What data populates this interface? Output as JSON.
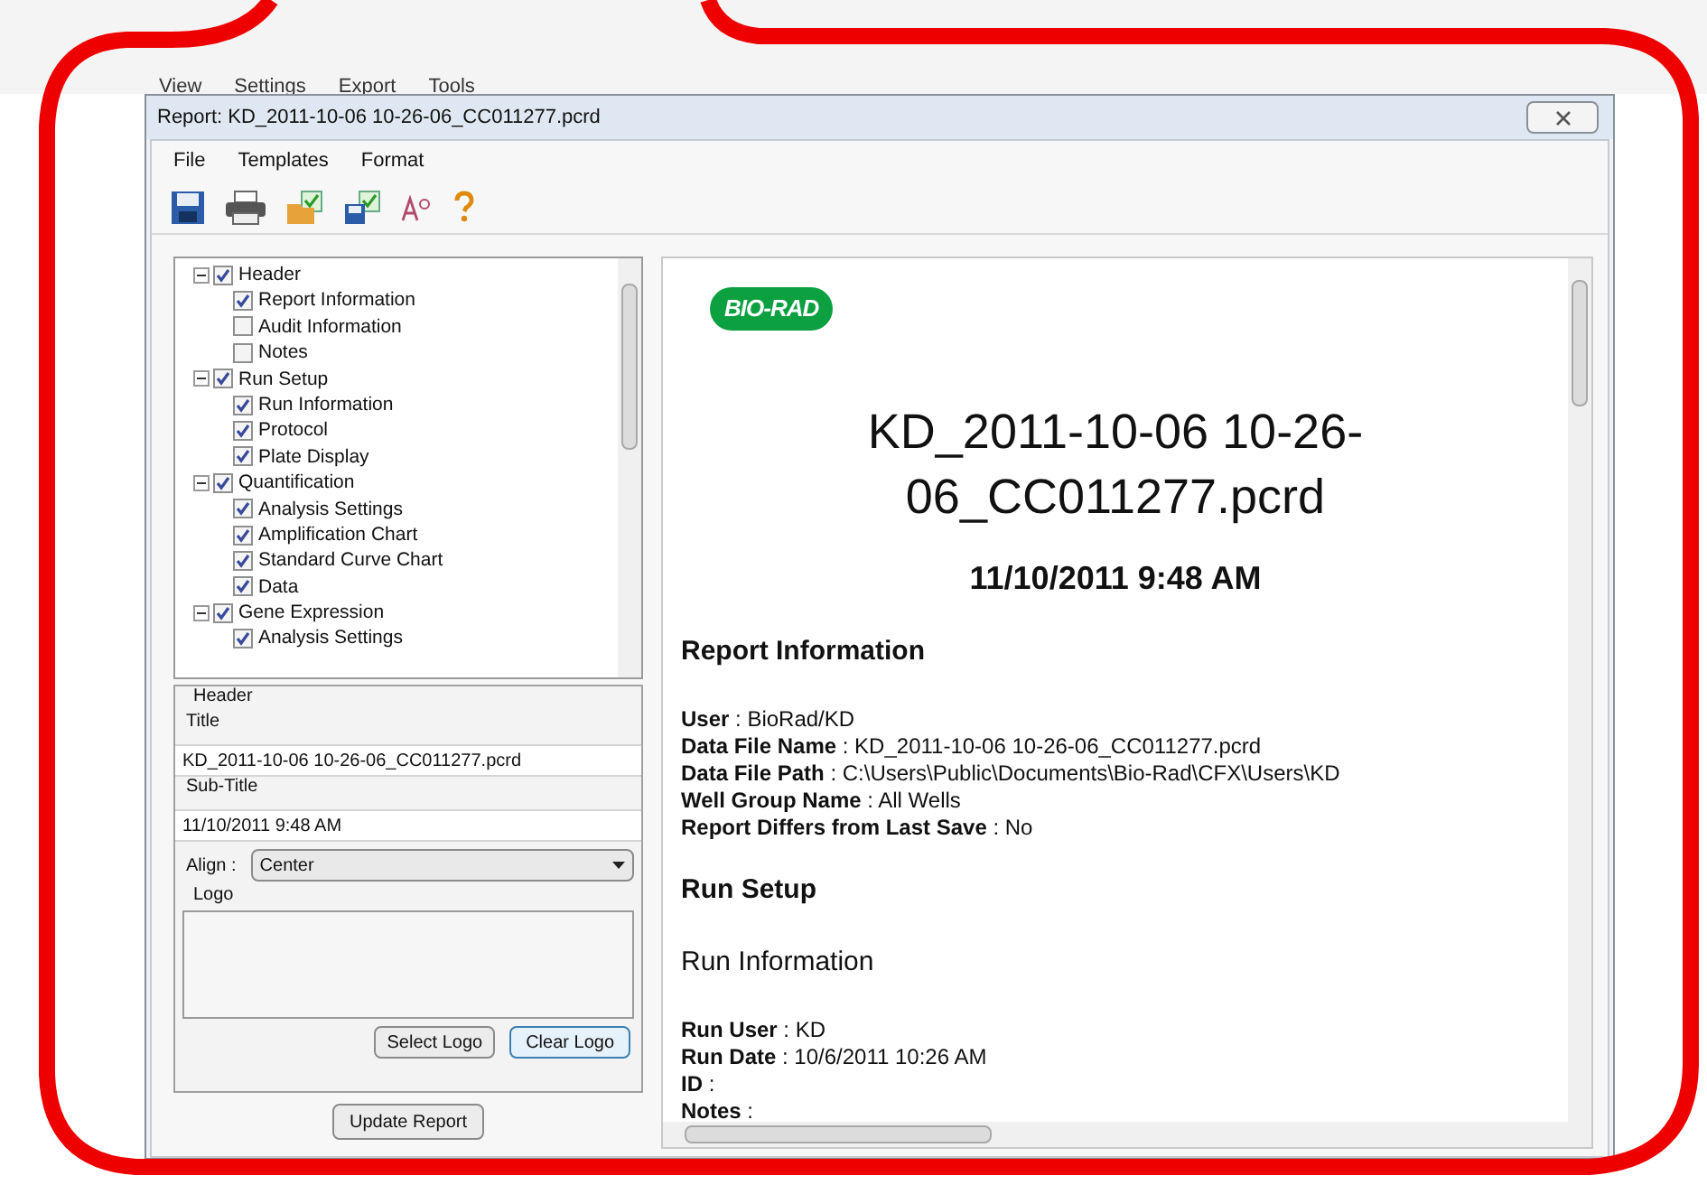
{
  "background_menu": [
    "View",
    "Settings",
    "Export",
    "Tools"
  ],
  "window": {
    "title": "Report: KD_2011-10-06 10-26-06_CC011277.pcrd"
  },
  "menu": [
    "File",
    "Templates",
    "Format"
  ],
  "tree": [
    {
      "label": "Header",
      "checked": true,
      "expanded": true,
      "children": [
        {
          "label": "Report Information",
          "checked": true
        },
        {
          "label": "Audit Information",
          "checked": false
        },
        {
          "label": "Notes",
          "checked": false
        }
      ]
    },
    {
      "label": "Run Setup",
      "checked": true,
      "expanded": true,
      "children": [
        {
          "label": "Run Information",
          "checked": true
        },
        {
          "label": "Protocol",
          "checked": true
        },
        {
          "label": "Plate Display",
          "checked": true
        }
      ]
    },
    {
      "label": "Quantification",
      "checked": true,
      "expanded": true,
      "children": [
        {
          "label": "Analysis Settings",
          "checked": true
        },
        {
          "label": "Amplification Chart",
          "checked": true
        },
        {
          "label": "Standard Curve Chart",
          "checked": true
        },
        {
          "label": "Data",
          "checked": true
        }
      ]
    },
    {
      "label": "Gene Expression",
      "checked": true,
      "expanded": true,
      "children": [
        {
          "label": "Analysis Settings",
          "checked": true
        }
      ]
    }
  ],
  "properties": {
    "group": "Header",
    "title_label": "Title",
    "title_value": "KD_2011-10-06 10-26-06_CC011277.pcrd",
    "subtitle_label": "Sub-Title",
    "subtitle_value": "11/10/2011 9:48 AM",
    "align_label": "Align :",
    "align_value": "Center",
    "logo_label": "Logo",
    "select_logo": "Select Logo",
    "clear_logo": "Clear Logo"
  },
  "update_button": "Update Report",
  "report": {
    "logo": "BIO-RAD",
    "title": "KD_2011-10-06 10-26-06_CC011277.pcrd",
    "date": "11/10/2011 9:48 AM",
    "sections": [
      {
        "kind": "heading",
        "text": "Report Information"
      },
      {
        "kind": "fields",
        "fields": [
          "**User** : BioRad/KD",
          "**Data File Name** : KD_2011-10-06 10-26-06_CC011277.pcrd",
          "**Data File Path** : C:\\Users\\Public\\Documents\\Bio-Rad\\CFX\\Users\\KD",
          "**Well Group Name** : All Wells",
          "**Report Differs from Last Save** : No"
        ]
      },
      {
        "kind": "heading",
        "text": "Run Setup"
      },
      {
        "kind": "subheading",
        "text": "Run Information"
      },
      {
        "kind": "fields",
        "fields": [
          "**Run User** : KD",
          "**Run Date** : 10/6/2011 10:26 AM",
          "**ID** :",
          "**Notes** :"
        ]
      }
    ]
  }
}
